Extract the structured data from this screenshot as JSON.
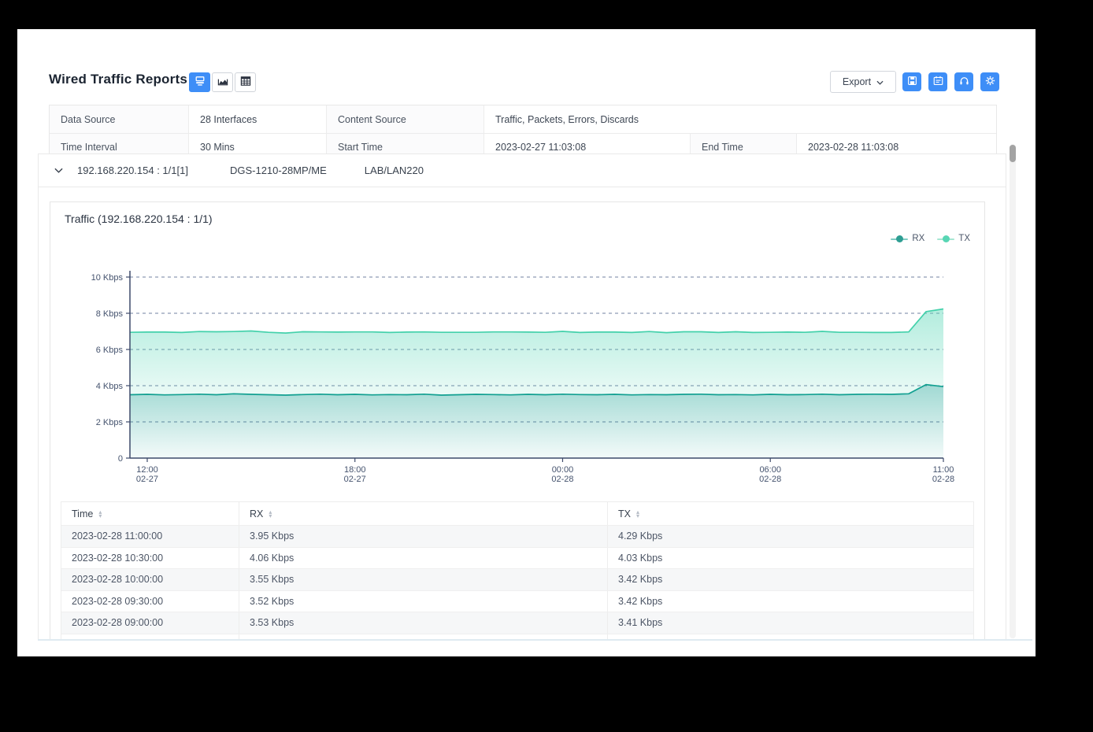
{
  "colors": {
    "accent_blue": "#3e8ef7",
    "rx": "#12a091",
    "tx": "#44d1ab",
    "rx_dot": "#2e9e93",
    "tx_dot": "#58d6b4",
    "axis": "#3d4a6a",
    "grid": "#5a6b92"
  },
  "header": {
    "title": "Wired Traffic Reports",
    "view_toggles": [
      {
        "name": "combined-view",
        "active": true
      },
      {
        "name": "chart-view",
        "active": false
      },
      {
        "name": "table-view",
        "active": false
      }
    ],
    "export_label": "Export",
    "action_icons": [
      "save-icon",
      "schedule-icon",
      "support-icon",
      "settings-icon"
    ]
  },
  "summary": {
    "row1": [
      {
        "label": "Data Source",
        "value": "28 Interfaces"
      },
      {
        "label": "Content Source",
        "value": "Traffic, Packets, Errors, Discards"
      }
    ],
    "row2": [
      {
        "label": "Time Interval",
        "value": "30 Mins"
      },
      {
        "label": "Start Time",
        "value": "2023-02-27 11:03:08"
      },
      {
        "label": "End Time",
        "value": "2023-02-28 11:03:08"
      }
    ]
  },
  "device": {
    "ip_port": "192.168.220.154 : 1/1[1]",
    "model": "DGS-1210-28MP/ME",
    "network": "LAB/LAN220"
  },
  "panel": {
    "title": "Traffic (192.168.220.154 : 1/1)",
    "legend": [
      {
        "label": "RX",
        "dot": "#2e9e93",
        "line": "#7fccc2"
      },
      {
        "label": "TX",
        "dot": "#58d6b4",
        "line": "#a5e6d2"
      }
    ]
  },
  "chart_data": {
    "type": "area",
    "stacked": true,
    "title": "Traffic (192.168.220.154 : 1/1)",
    "unit": "Kbps",
    "ylim": [
      0,
      10
    ],
    "grid": "dashed-horizontal",
    "legend_position": "top-right",
    "yticks": [
      {
        "v": 0,
        "label": "0"
      },
      {
        "v": 2,
        "label": "2 Kbps"
      },
      {
        "v": 4,
        "label": "4 Kbps"
      },
      {
        "v": 6,
        "label": "6 Kbps"
      },
      {
        "v": 8,
        "label": "8 Kbps"
      },
      {
        "v": 10,
        "label": "10 Kbps"
      }
    ],
    "xticks": [
      {
        "i": 1,
        "time": "12:00",
        "date": "02-27"
      },
      {
        "i": 13,
        "time": "18:00",
        "date": "02-27"
      },
      {
        "i": 25,
        "time": "00:00",
        "date": "02-28"
      },
      {
        "i": 37,
        "time": "06:00",
        "date": "02-28"
      },
      {
        "i": 47,
        "time": "11:00",
        "date": "02-28"
      }
    ],
    "x": [
      "02-27 11:30",
      "02-27 12:00",
      "02-27 12:30",
      "02-27 13:00",
      "02-27 13:30",
      "02-27 14:00",
      "02-27 14:30",
      "02-27 15:00",
      "02-27 15:30",
      "02-27 16:00",
      "02-27 16:30",
      "02-27 17:00",
      "02-27 17:30",
      "02-27 18:00",
      "02-27 18:30",
      "02-27 19:00",
      "02-27 19:30",
      "02-27 20:00",
      "02-27 20:30",
      "02-27 21:00",
      "02-27 21:30",
      "02-27 22:00",
      "02-27 22:30",
      "02-27 23:00",
      "02-27 23:30",
      "02-28 00:00",
      "02-28 00:30",
      "02-28 01:00",
      "02-28 01:30",
      "02-28 02:00",
      "02-28 02:30",
      "02-28 03:00",
      "02-28 03:30",
      "02-28 04:00",
      "02-28 04:30",
      "02-28 05:00",
      "02-28 05:30",
      "02-28 06:00",
      "02-28 06:30",
      "02-28 07:00",
      "02-28 07:30",
      "02-28 08:00",
      "02-28 08:30",
      "02-28 09:00",
      "02-28 09:30",
      "02-28 10:00",
      "02-28 10:30",
      "02-28 11:00"
    ],
    "series": [
      {
        "name": "RX",
        "color": "#12a091",
        "values": [
          3.5,
          3.52,
          3.49,
          3.51,
          3.53,
          3.5,
          3.55,
          3.52,
          3.5,
          3.48,
          3.51,
          3.53,
          3.5,
          3.52,
          3.49,
          3.51,
          3.5,
          3.53,
          3.48,
          3.5,
          3.52,
          3.51,
          3.49,
          3.52,
          3.5,
          3.53,
          3.51,
          3.5,
          3.52,
          3.49,
          3.51,
          3.5,
          3.52,
          3.53,
          3.5,
          3.51,
          3.49,
          3.52,
          3.5,
          3.51,
          3.53,
          3.5,
          3.52,
          3.53,
          3.52,
          3.55,
          4.06,
          3.95
        ]
      },
      {
        "name": "TX",
        "color": "#44d1ab",
        "values": [
          3.45,
          3.44,
          3.47,
          3.43,
          3.46,
          3.48,
          3.44,
          3.5,
          3.45,
          3.43,
          3.47,
          3.44,
          3.46,
          3.45,
          3.48,
          3.43,
          3.46,
          3.44,
          3.47,
          3.45,
          3.43,
          3.46,
          3.48,
          3.44,
          3.45,
          3.47,
          3.43,
          3.46,
          3.44,
          3.45,
          3.48,
          3.43,
          3.46,
          3.45,
          3.44,
          3.47,
          3.45,
          3.43,
          3.46,
          3.44,
          3.47,
          3.45,
          3.43,
          3.41,
          3.42,
          3.42,
          4.03,
          4.29
        ]
      }
    ]
  },
  "table": {
    "columns": [
      "Time",
      "RX",
      "TX"
    ],
    "rows": [
      [
        "2023-02-28 11:00:00",
        "3.95 Kbps",
        "4.29 Kbps"
      ],
      [
        "2023-02-28 10:30:00",
        "4.06 Kbps",
        "4.03 Kbps"
      ],
      [
        "2023-02-28 10:00:00",
        "3.55 Kbps",
        "3.42 Kbps"
      ],
      [
        "2023-02-28 09:30:00",
        "3.52 Kbps",
        "3.42 Kbps"
      ],
      [
        "2023-02-28 09:00:00",
        "3.53 Kbps",
        "3.41 Kbps"
      ]
    ],
    "partial_row": [
      "",
      "",
      ""
    ]
  }
}
